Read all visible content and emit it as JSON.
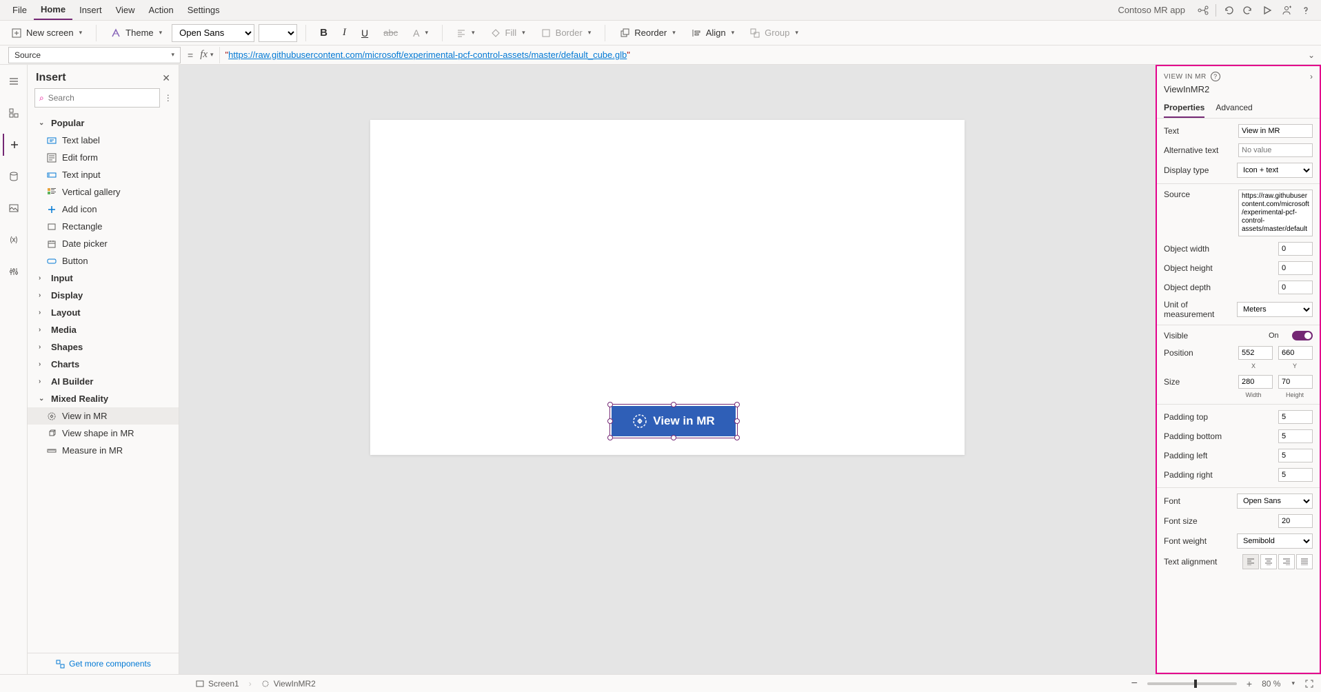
{
  "menu": {
    "file": "File",
    "home": "Home",
    "insert": "Insert",
    "view": "View",
    "action": "Action",
    "settings": "Settings"
  },
  "app_title": "Contoso MR app",
  "ribbon": {
    "new_screen": "New screen",
    "theme": "Theme",
    "font_family": "Open Sans",
    "fill": "Fill",
    "border": "Border",
    "reorder": "Reorder",
    "align": "Align",
    "group": "Group"
  },
  "formula": {
    "property": "Source",
    "value": "https://raw.githubusercontent.com/microsoft/experimental-pcf-control-assets/master/default_cube.glb"
  },
  "insert_pane": {
    "title": "Insert",
    "search_placeholder": "Search",
    "group_popular": "Popular",
    "items": {
      "text_label": "Text label",
      "edit_form": "Edit form",
      "text_input": "Text input",
      "vertical_gallery": "Vertical gallery",
      "add_icon": "Add icon",
      "rectangle": "Rectangle",
      "date_picker": "Date picker",
      "button": "Button"
    },
    "groups": {
      "input": "Input",
      "display": "Display",
      "layout": "Layout",
      "media": "Media",
      "shapes": "Shapes",
      "charts": "Charts",
      "ai_builder": "AI Builder",
      "mixed_reality": "Mixed Reality"
    },
    "mr": {
      "view_in_mr": "View in MR",
      "view_shape_in_mr": "View shape in MR",
      "measure_in_mr": "Measure in MR"
    },
    "footer": "Get more components"
  },
  "canvas": {
    "button_label": "View in MR"
  },
  "properties_pane": {
    "control_type": "VIEW IN MR",
    "control_name": "ViewInMR2",
    "tabs": {
      "properties": "Properties",
      "advanced": "Advanced"
    },
    "rows": {
      "text": "Text",
      "text_val": "View in MR",
      "alt": "Alternative text",
      "alt_ph": "No value",
      "display_type": "Display type",
      "display_type_val": "Icon + text",
      "source": "Source",
      "source_val": "https://raw.githubusercontent.com/microsoft/experimental-pcf-control-assets/master/default_",
      "obj_w": "Object width",
      "obj_w_val": "0",
      "obj_h": "Object height",
      "obj_h_val": "0",
      "obj_d": "Object depth",
      "obj_d_val": "0",
      "unit": "Unit of measurement",
      "unit_val": "Meters",
      "visible": "Visible",
      "visible_val": "On",
      "position": "Position",
      "pos_x": "552",
      "pos_y": "660",
      "pos_x_lbl": "X",
      "pos_y_lbl": "Y",
      "size": "Size",
      "size_w": "280",
      "size_h": "70",
      "size_w_lbl": "Width",
      "size_h_lbl": "Height",
      "pad_t": "Padding top",
      "pad_t_val": "5",
      "pad_b": "Padding bottom",
      "pad_b_val": "5",
      "pad_l": "Padding left",
      "pad_l_val": "5",
      "pad_r": "Padding right",
      "pad_r_val": "5",
      "font": "Font",
      "font_val": "Open Sans",
      "font_size": "Font size",
      "font_size_val": "20",
      "font_weight": "Font weight",
      "font_weight_val": "Semibold",
      "text_align": "Text alignment"
    }
  },
  "status": {
    "screen": "Screen1",
    "control": "ViewInMR2",
    "zoom": "80 %"
  }
}
